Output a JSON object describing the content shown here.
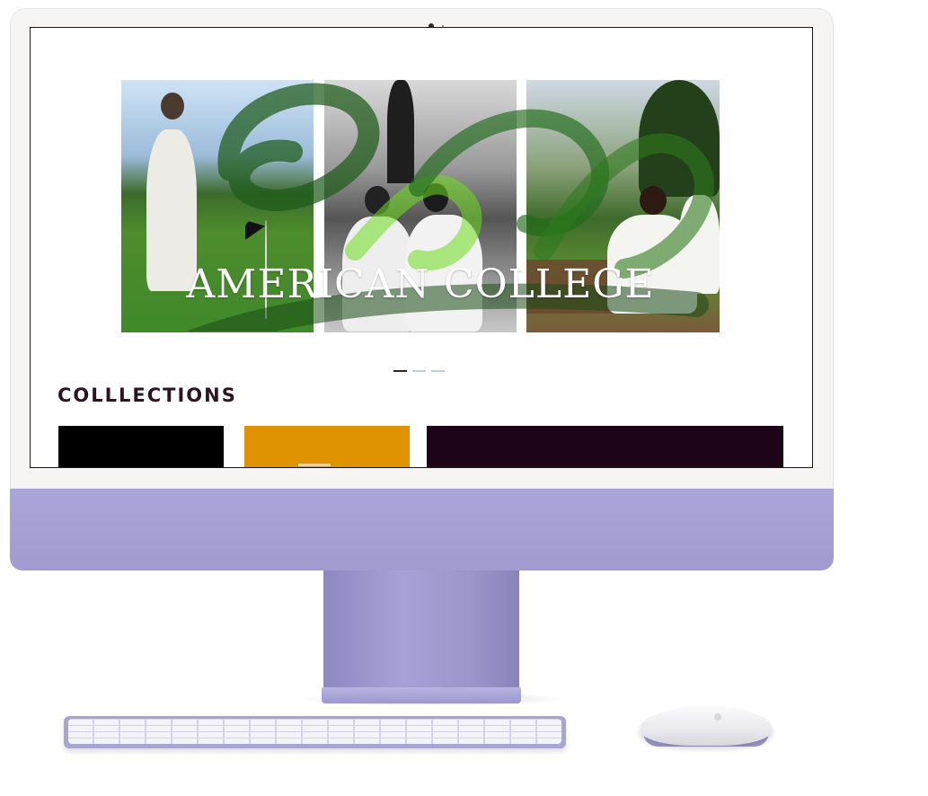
{
  "hero": {
    "title": "AMERICAN COLLEGE",
    "slides": 3,
    "active_slide": 1
  },
  "collections": {
    "title": "COLLLECTIONS",
    "cards": [
      {
        "color": "#000000"
      },
      {
        "color": "#e09300"
      },
      {
        "color": "#1e0417"
      }
    ]
  },
  "device": {
    "accent": "#a9a4d6",
    "type": "iMac"
  }
}
